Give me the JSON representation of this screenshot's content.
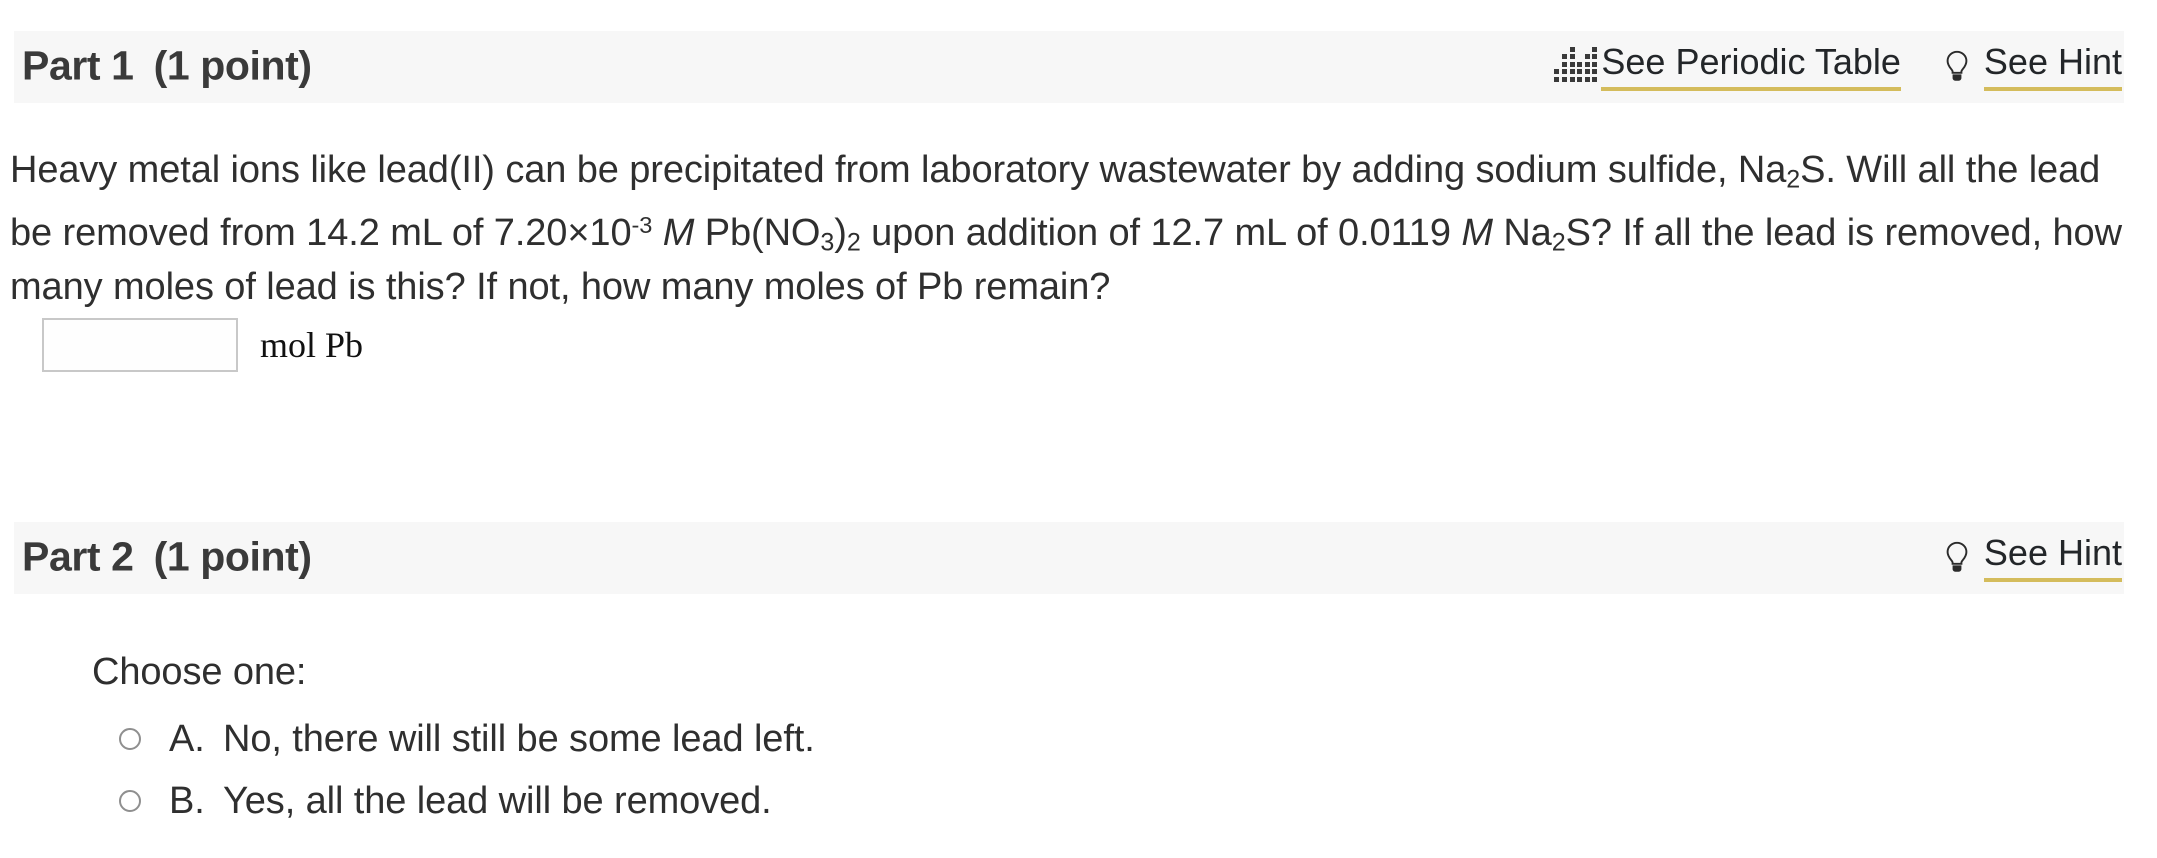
{
  "part1": {
    "title_part": "Part 1",
    "title_points": "(1 point)",
    "links": {
      "periodic_table": "See Periodic Table",
      "hint": "See Hint"
    },
    "question_html": "Heavy metal ions like lead(II) can be precipitated from laboratory wastewater by adding sodium sulfide, Na2S. Will all the lead be removed from 14.2 mL of 7.20×10-3 M Pb(NO3)2 upon addition of 12.7 mL of 0.0119 M Na2S? If all the lead is removed, how many moles of lead is this? If not, how many moles of Pb remain?",
    "question_segments": [
      "Heavy metal ions like lead(II) can be precipitated from laboratory wastewater by adding sodium sulfide, Na",
      "2",
      "S. Will all the lead be removed from 14.2 mL of 7.20×10",
      "-3",
      " ",
      "M",
      " Pb(NO",
      "3",
      ")",
      "2",
      " upon addition of 12.7 mL of 0.0119 ",
      "M",
      " Na",
      "2",
      "S? If all the lead is removed, how many moles of lead is this? If not, how many moles of Pb remain?"
    ],
    "answer": {
      "value": "",
      "placeholder": "",
      "unit": "mol Pb"
    }
  },
  "part2": {
    "title_part": "Part 2",
    "title_points": "(1 point)",
    "links": {
      "hint": "See Hint"
    },
    "choose_label": "Choose one:",
    "choices": [
      {
        "letter": "A.",
        "text": "No, there will still be some lead left.",
        "selected": false
      },
      {
        "letter": "B.",
        "text": "Yes, all the lead will be removed.",
        "selected": false
      }
    ]
  },
  "colors": {
    "header_band": "#f7f7f7",
    "link_underline": "#d4bc5c",
    "text": "#2f2f2f",
    "title_text": "#3a3a3a",
    "input_border": "#c8c8c8",
    "radio_border": "#8f8f8f",
    "page_background": "#ffffff"
  },
  "icons": {
    "periodic_table": "periodic-table-icon",
    "hint": "lightbulb-icon"
  }
}
